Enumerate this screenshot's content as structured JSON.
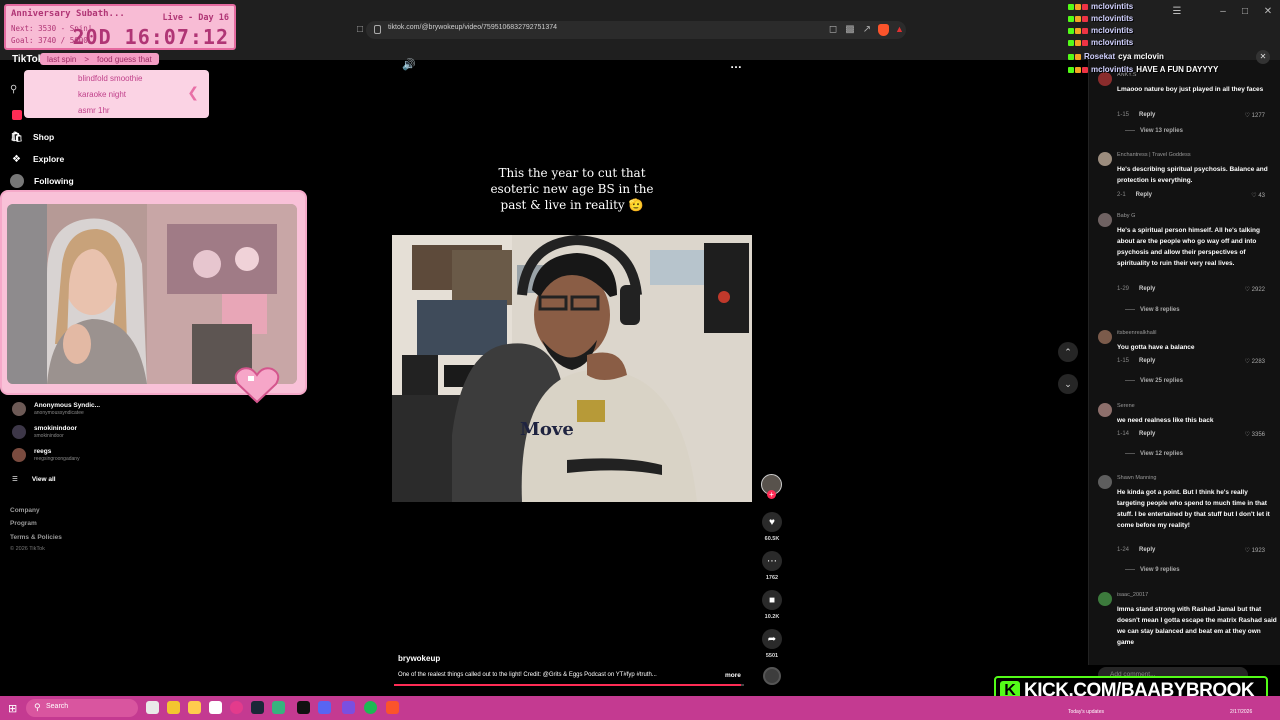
{
  "browser": {
    "url": "tiktok.com/@brywokeup/video/7595106832792751374"
  },
  "subathon": {
    "title": "Anniversary Subath...",
    "next": "Next: 3530 - Spin!",
    "goal": "Goal: 3740 / 5000",
    "day": "Live - Day 16",
    "timer": "20D 16:07:12"
  },
  "spin_wheel": {
    "tabs": [
      "last spin",
      ">",
      "food guess that"
    ],
    "options": [
      "blindfold smoothie",
      "karaoke night",
      "asmr 1hr"
    ]
  },
  "sidebar": {
    "logo": "TikTok",
    "nav": [
      {
        "label": "Shop",
        "icon": "shop-icon"
      },
      {
        "label": "Explore",
        "icon": "compass-icon"
      },
      {
        "label": "Following",
        "icon": "avatar"
      }
    ],
    "following": [
      {
        "name": "Anonymous Syndic...",
        "handle": "anonymoussyndicatee"
      },
      {
        "name": "smokinindoor",
        "handle": "smokinindoor"
      },
      {
        "name": "reegs",
        "handle": "reegsingroongadany"
      }
    ],
    "view_all": "View all",
    "footer": [
      "Company",
      "Program",
      "Terms & Policies"
    ],
    "copyright": "© 2026 TikTok"
  },
  "video": {
    "caption_lines": [
      "This the year to cut that",
      "esoteric new age BS in the",
      "past & live in reality 🫡"
    ],
    "author": "brywokeup",
    "description": "One of the realest things called out to the light! Credit: @Grits & Eggs Podcast on YT#fyp #truth...",
    "more": "more",
    "progress": 0.99,
    "shirt_text": "Move"
  },
  "actions": {
    "likes": "60.5K",
    "comments": "1762",
    "saves": "10.2K",
    "shares": "5501"
  },
  "comments": [
    {
      "user": "ANKY.S",
      "text": "Lmaooo nature boy just played in all they faces",
      "time": "1-15",
      "reply": "Reply",
      "likes": "1277",
      "replies": "View 13 replies"
    },
    {
      "user": "Enchantress | Travel Goddess",
      "text": "He's describing spiritual psychosis. Balance and protection is everything.",
      "time": "2-1",
      "reply": "Reply",
      "likes": "43",
      "replies": ""
    },
    {
      "user": "Baby G",
      "text": "He's a spiritual person himself. All he's talking about are the people who go way off and into psychosis and allow their perspectives of spirituality to ruin their very real lives.",
      "time": "1-29",
      "reply": "Reply",
      "likes": "2922",
      "replies": "View 8 replies"
    },
    {
      "user": "itsbeenrealkhalil",
      "text": "You gotta have a balance",
      "time": "1-15",
      "reply": "Reply",
      "likes": "2283",
      "replies": "View 25 replies"
    },
    {
      "user": "Serene",
      "text": "we need realness like this back",
      "time": "1-14",
      "reply": "Reply",
      "likes": "3356",
      "replies": "View 12 replies"
    },
    {
      "user": "Shawn Manning",
      "text": "He kinda got a point. But I think he's really targeting people who spend to much time in that stuff. I be entertained by that stuff but I don't let it come before my reality!",
      "time": "1-24",
      "reply": "Reply",
      "likes": "1923",
      "replies": "View 9 replies"
    },
    {
      "user": "isaac_20017",
      "text": "Imma stand strong with Rashad Jamal but that doesn't mean I gotta escape the matrix Rashad said we can stay balanced and beat em at they own game",
      "time": "",
      "reply": "",
      "likes": "",
      "replies": ""
    }
  ],
  "add_comment": "Add comment...",
  "chat": [
    {
      "nick": "mclovintits",
      "msg": ""
    },
    {
      "nick": "mclovintits",
      "msg": ""
    },
    {
      "nick": "mclovintits",
      "msg": ""
    },
    {
      "nick": "mclovintits",
      "msg": ""
    },
    {
      "nick": "Rosekat",
      "msg": "cya mclovin"
    },
    {
      "nick": "mclovintits",
      "msg": "HAVE A FUN DAYYYY"
    }
  ],
  "kick_banner": "KICK.COM/BAABYBROOK",
  "taskbar": {
    "search": "Search",
    "updates": "Today's updates",
    "date": "2/17/2026"
  },
  "colors": {
    "accent": "#fe2c55",
    "overlay_pink": "#f8bcd5",
    "taskbar": "#c43a91",
    "kick_green": "#53fc18"
  }
}
